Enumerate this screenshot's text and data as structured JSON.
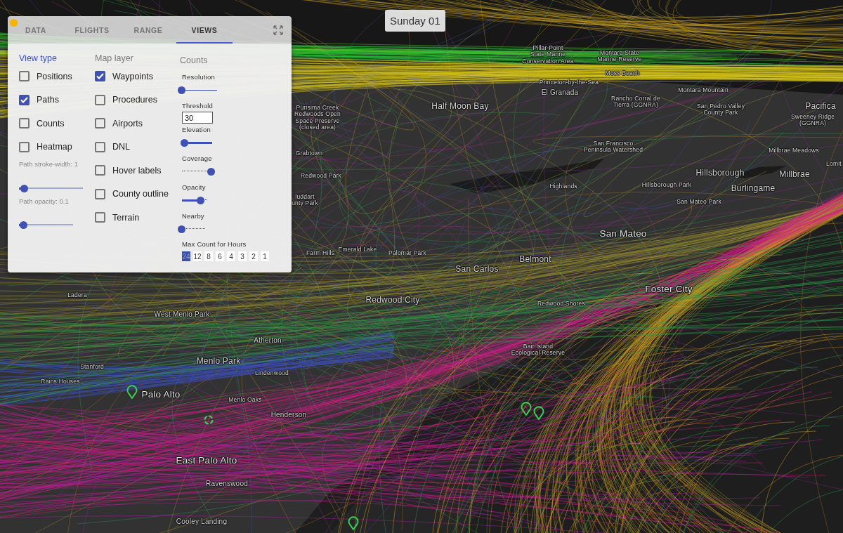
{
  "date_label": "Sunday 01",
  "panel": {
    "tabs": [
      {
        "label": "DATA",
        "selected": false
      },
      {
        "label": "FLIGHTS",
        "selected": false
      },
      {
        "label": "RANGE",
        "selected": false
      },
      {
        "label": "VIEWS",
        "selected": true
      }
    ],
    "view_type": {
      "title": "View type",
      "active": true,
      "options": [
        {
          "label": "Positions",
          "checked": false
        },
        {
          "label": "Paths",
          "checked": true
        },
        {
          "label": "Counts",
          "checked": false
        },
        {
          "label": "Heatmap",
          "checked": false
        }
      ]
    },
    "path_sliders": [
      {
        "label": "Path stroke-width: 1",
        "level": 0.09
      },
      {
        "label": "Path opacity: 0.1",
        "level": 0.09
      }
    ],
    "map_layer": {
      "title": "Map layer",
      "active": false,
      "options": [
        {
          "label": "Waypoints",
          "checked": true
        },
        {
          "label": "Procedures",
          "checked": false
        },
        {
          "label": "Airports",
          "checked": false
        },
        {
          "label": "DNL",
          "checked": false
        },
        {
          "label": "Hover labels",
          "checked": false
        },
        {
          "label": "County outline",
          "checked": false
        },
        {
          "label": "Terrain",
          "checked": false
        }
      ]
    },
    "counts": {
      "title": "Counts",
      "active": false,
      "controls": [
        {
          "kind": "slider",
          "label": "Resolution",
          "level": 0,
          "stepped": false,
          "inverted": false
        },
        {
          "kind": "input",
          "label": "Threshold",
          "value": "30"
        },
        {
          "kind": "slider",
          "label": "Elevation",
          "level": 0.09,
          "inverted": true
        },
        {
          "kind": "slider",
          "label": "Coverage",
          "level": 1,
          "stepped": true,
          "inverted": true
        },
        {
          "kind": "slider",
          "label": "Opacity",
          "level": 0.75,
          "stepped": true,
          "inverted": false
        },
        {
          "kind": "slider",
          "label": "Nearby",
          "level": 0,
          "stepped": true,
          "inverted": false
        }
      ],
      "max_count": {
        "label": "Max Count for Hours",
        "options": [
          {
            "label": "24",
            "selected": true
          },
          {
            "label": "12",
            "selected": false
          },
          {
            "label": "8",
            "selected": false
          },
          {
            "label": "6",
            "selected": false
          },
          {
            "label": "4",
            "selected": false
          },
          {
            "label": "3",
            "selected": false
          },
          {
            "label": "2",
            "selected": false
          },
          {
            "label": "1",
            "selected": false
          }
        ]
      }
    }
  },
  "map": {
    "labels": [
      {
        "kind": "place",
        "lines": [
          "Pillar Point",
          "State Marine",
          "Conservation Area"
        ]
      },
      {
        "kind": "place",
        "lines": [
          "Montara State",
          "Marine Reserve"
        ]
      },
      {
        "kind": "place",
        "lines": [
          "Moss Beach"
        ]
      },
      {
        "kind": "place",
        "lines": [
          "Princeton-by-the-Sea"
        ]
      },
      {
        "kind": "town",
        "lines": [
          "El Granada"
        ]
      },
      {
        "kind": "place",
        "lines": [
          "Montara Mountain"
        ]
      },
      {
        "kind": "place",
        "lines": [
          "Purisima Creek",
          "Redwoods Open",
          "Space Preserve",
          "(closed area)"
        ]
      },
      {
        "kind": "city",
        "lines": [
          "Half Moon Bay"
        ]
      },
      {
        "kind": "place",
        "lines": [
          "Rancho Corral de",
          "Tierra (GGNRA)"
        ]
      },
      {
        "kind": "place",
        "lines": [
          "San Pedro Valley",
          "County Park"
        ]
      },
      {
        "kind": "city",
        "lines": [
          "Pacifica"
        ]
      },
      {
        "kind": "place",
        "lines": [
          "Sweeney Ridge",
          "(GGNRA)"
        ]
      },
      {
        "kind": "place",
        "lines": [
          "Grabtown"
        ]
      },
      {
        "kind": "place",
        "lines": [
          "San Francisco",
          "Peninsula Watershed"
        ]
      },
      {
        "kind": "place",
        "lines": [
          "Millbrae Meadows"
        ]
      },
      {
        "kind": "place",
        "lines": [
          "Lomit"
        ]
      },
      {
        "kind": "place",
        "lines": [
          "Redwood Park"
        ]
      },
      {
        "kind": "city",
        "lines": [
          "Hillsborough"
        ]
      },
      {
        "kind": "city",
        "lines": [
          "Millbrae"
        ]
      },
      {
        "kind": "place",
        "lines": [
          "Highlands"
        ]
      },
      {
        "kind": "place",
        "lines": [
          "Hillsborough Park"
        ]
      },
      {
        "kind": "city",
        "lines": [
          "Burlingame"
        ]
      },
      {
        "kind": "place",
        "lines": [
          "luddart",
          "unty Park"
        ]
      },
      {
        "kind": "place",
        "lines": [
          "San Mateo Park"
        ]
      },
      {
        "kind": "major",
        "lines": [
          "San Mateo"
        ]
      },
      {
        "kind": "place",
        "lines": [
          "Farm Hills"
        ]
      },
      {
        "kind": "place",
        "lines": [
          "Emerald Lake"
        ]
      },
      {
        "kind": "place",
        "lines": [
          "Palomar Park"
        ]
      },
      {
        "kind": "city",
        "lines": [
          "Belmont"
        ]
      },
      {
        "kind": "city",
        "lines": [
          "San Carlos"
        ]
      },
      {
        "kind": "place",
        "lines": [
          "Ladera"
        ]
      },
      {
        "kind": "major",
        "lines": [
          "Foster City"
        ]
      },
      {
        "kind": "city",
        "lines": [
          "Redwood City"
        ]
      },
      {
        "kind": "place",
        "lines": [
          "Redwood Shores"
        ]
      },
      {
        "kind": "town",
        "lines": [
          "West Menlo Park"
        ]
      },
      {
        "kind": "town",
        "lines": [
          "Atherton"
        ]
      },
      {
        "kind": "place",
        "lines": [
          "Bair Island",
          "Ecological Reserve"
        ]
      },
      {
        "kind": "place",
        "lines": [
          "Stanford"
        ]
      },
      {
        "kind": "city",
        "lines": [
          "Menlo Park"
        ]
      },
      {
        "kind": "place",
        "lines": [
          "Lindenwood"
        ]
      },
      {
        "kind": "place",
        "lines": [
          "Rains Houses"
        ]
      },
      {
        "kind": "major",
        "lines": [
          "Palo Alto"
        ]
      },
      {
        "kind": "place",
        "lines": [
          "Menlo Oaks"
        ]
      },
      {
        "kind": "town",
        "lines": [
          "Henderson"
        ]
      },
      {
        "kind": "major",
        "lines": [
          "East Palo Alto"
        ]
      },
      {
        "kind": "town",
        "lines": [
          "Ravenswood"
        ]
      },
      {
        "kind": "town",
        "lines": [
          "Cooley Landing"
        ]
      }
    ]
  }
}
